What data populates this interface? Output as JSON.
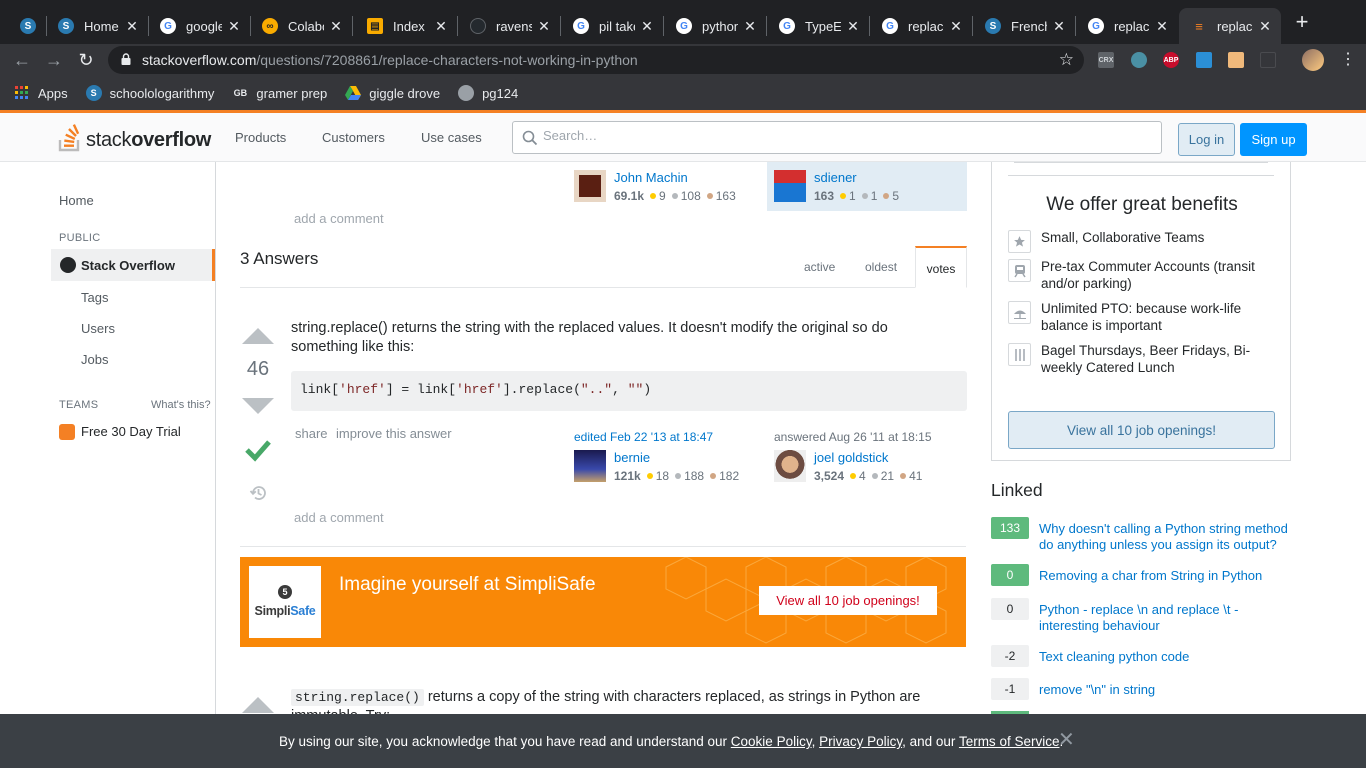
{
  "browser": {
    "tabs": [
      {
        "title": "",
        "icon": "schoology-icon",
        "color": "#2a7ab0"
      },
      {
        "title": "Home |",
        "icon": "schoology-icon",
        "color": "#2a7ab0"
      },
      {
        "title": "google",
        "icon": "google-icon",
        "color": "#4285f4"
      },
      {
        "title": "Colabo",
        "icon": "colab-icon",
        "color": "#f9ab00"
      },
      {
        "title": "Index",
        "icon": "book-icon",
        "color": "#f9ab00"
      },
      {
        "title": "ravens",
        "icon": "github-icon",
        "color": "#24292e"
      },
      {
        "title": "pil take",
        "icon": "google-icon",
        "color": "#4285f4"
      },
      {
        "title": "python",
        "icon": "google-icon",
        "color": "#4285f4"
      },
      {
        "title": "TypeEr",
        "icon": "google-icon",
        "color": "#4285f4"
      },
      {
        "title": "replace",
        "icon": "google-icon",
        "color": "#4285f4"
      },
      {
        "title": "French",
        "icon": "schoology-icon",
        "color": "#2a7ab0"
      },
      {
        "title": "replac",
        "icon": "google-icon",
        "color": "#4285f4"
      },
      {
        "title": "replace",
        "icon": "stackoverflow-icon",
        "color": "#f48024",
        "active": true
      }
    ],
    "url_host": "stackoverflow.com",
    "url_path": "/questions/7208861/replace-characters-not-working-in-python",
    "extensions": [
      "CRX",
      "",
      "ABP",
      "",
      ""
    ],
    "bookmarks": [
      {
        "label": "Apps",
        "icon": "apps-grid-icon"
      },
      {
        "label": "schoolologarithmy",
        "icon": "schoology-icon"
      },
      {
        "label": "gramer prep",
        "icon": "gb-icon"
      },
      {
        "label": "giggle drove",
        "icon": "drive-icon"
      },
      {
        "label": "pg124",
        "icon": "globe-icon"
      }
    ]
  },
  "so_header": {
    "logo_plain": "stack",
    "logo_bold": "overflow",
    "nav": [
      "Products",
      "Customers",
      "Use cases"
    ],
    "search_placeholder": "Search…",
    "login": "Log in",
    "signup": "Sign up"
  },
  "left_nav": {
    "home": "Home",
    "public_heading": "PUBLIC",
    "active": "Stack Overflow",
    "tags": "Tags",
    "users": "Users",
    "jobs": "Jobs",
    "teams_heading": "TEAMS",
    "whats_this": "What's this?",
    "trial": "Free 30 Day Trial"
  },
  "question_footer": {
    "editor": {
      "name": "John Machin",
      "rep": "69.1k",
      "gold": "9",
      "silver": "108",
      "bronze": "163"
    },
    "asker": {
      "name": "sdiener",
      "rep": "163",
      "gold": "1",
      "silver": "1",
      "bronze": "5"
    },
    "add_comment": "add a comment"
  },
  "answers": {
    "heading": "3 Answers",
    "sort_tabs": [
      "active",
      "oldest",
      "votes"
    ],
    "first": {
      "votes": "46",
      "text": "string.replace() returns the string with the replaced values. It doesn't modify the original so do something like this:",
      "code_a": "link[",
      "code_s1": "'href'",
      "code_b": "] = link[",
      "code_s2": "'href'",
      "code_c": "].replace(",
      "code_s3": "\"..\"",
      "code_d": ", ",
      "code_s4": "\"\"",
      "code_e": ")",
      "share": "share",
      "improve": "improve this answer",
      "edited_label": "edited Feb 22 '13 at 18:47",
      "editor": {
        "name": "bernie",
        "rep": "121k",
        "gold": "18",
        "silver": "188",
        "bronze": "182"
      },
      "answered_label": "answered Aug 26 '11 at 18:15",
      "author": {
        "name": "joel goldstick",
        "rep": "3,524",
        "gold": "4",
        "silver": "21",
        "bronze": "41"
      },
      "add_comment": "add a comment"
    },
    "second": {
      "code": "string.replace()",
      "text_rest": " returns a copy of the string with characters replaced, as strings in Python are",
      "text_cut": "immutable. Try:"
    }
  },
  "ad": {
    "brand_a": "Simpli",
    "brand_b": "Safe",
    "headline": "Imagine yourself at SimpliSafe",
    "cta": "View all 10 job openings!"
  },
  "jobs_box": {
    "title": "We offer great benefits",
    "benefits": [
      {
        "icon": "star-icon",
        "text": "Small, Collaborative Teams"
      },
      {
        "icon": "train-icon",
        "text": "Pre-tax Commuter Accounts (transit and/or parking)"
      },
      {
        "icon": "beach-icon",
        "text": "Unlimited PTO: because work-life balance is important"
      },
      {
        "icon": "utensils-icon",
        "text": "Bagel Thursdays, Beer Fridays, Bi-weekly Catered Lunch"
      }
    ],
    "button": "View all 10 job openings!"
  },
  "linked": {
    "title": "Linked",
    "items": [
      {
        "score": "133",
        "answered": true,
        "text": "Why doesn't calling a Python string method do anything unless you assign its output?"
      },
      {
        "score": "0",
        "answered": true,
        "text": "Removing a char from String in Python"
      },
      {
        "score": "0",
        "answered": false,
        "text": "Python - replace \\n and replace \\t - interesting behaviour"
      },
      {
        "score": "-2",
        "answered": false,
        "text": "Text cleaning python code"
      },
      {
        "score": "-1",
        "answered": false,
        "text": "remove \"\\n\" in string"
      }
    ]
  },
  "cookie": {
    "pre": "By using our site, you acknowledge that you have read and understand our ",
    "cookie_policy": "Cookie Policy",
    "sep1": ", ",
    "privacy_policy": "Privacy Policy",
    "sep2": ", and our ",
    "terms": "Terms of Service",
    "end": "."
  },
  "colors": {
    "so_orange": "#f48024",
    "link_blue": "#0077cc",
    "accepted_green": "#48a868",
    "ad_orange": "#f98807"
  }
}
